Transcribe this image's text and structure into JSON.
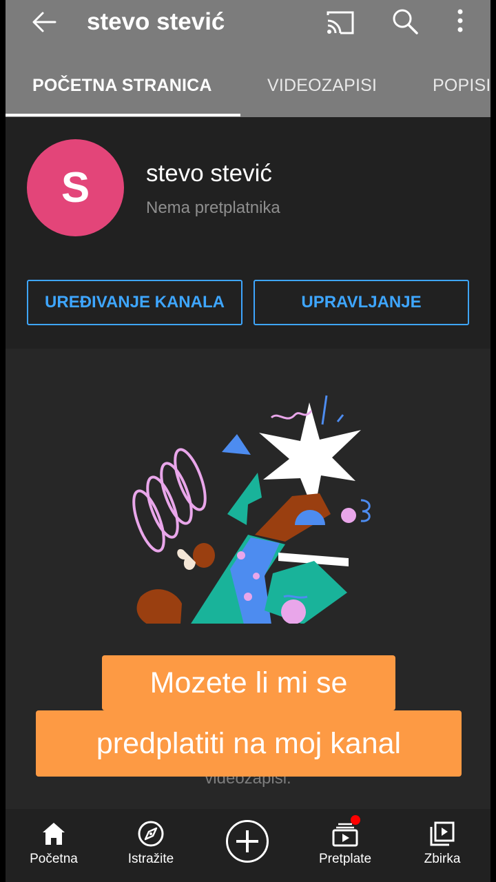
{
  "header": {
    "title": "stevo stević",
    "icons": [
      "back-arrow-icon",
      "cast-icon",
      "search-icon",
      "more-vert-icon"
    ]
  },
  "tabs": [
    {
      "label": "POČETNA STRANICA",
      "active": true
    },
    {
      "label": "VIDEOZAPISI",
      "active": false
    },
    {
      "label": "POPISI",
      "active": false
    }
  ],
  "channel": {
    "avatar_letter": "S",
    "avatar_color": "#e34579",
    "name": "stevo stević",
    "subscribers": "Nema pretplatnika",
    "edit_button": "UREĐIVANJE KANALA",
    "manage_button": "UPRAVLJANJE"
  },
  "content": {
    "empty_text": "videozapisi."
  },
  "overlay": {
    "line1": "Mozete li mi se",
    "line2": "predplatiti na moj kanal",
    "color": "#fd9a44"
  },
  "bottom_nav": {
    "items": [
      {
        "label": "Početna",
        "icon": "home-icon"
      },
      {
        "label": "Istražite",
        "icon": "explore-icon"
      },
      {
        "label": "",
        "icon": "create-plus-icon"
      },
      {
        "label": "Pretplate",
        "icon": "subscriptions-icon"
      },
      {
        "label": "Zbirka",
        "icon": "library-icon"
      }
    ]
  },
  "colors": {
    "accent": "#3ea6ff",
    "header_bg": "#7c7c7c",
    "notification": "#ff0000"
  }
}
